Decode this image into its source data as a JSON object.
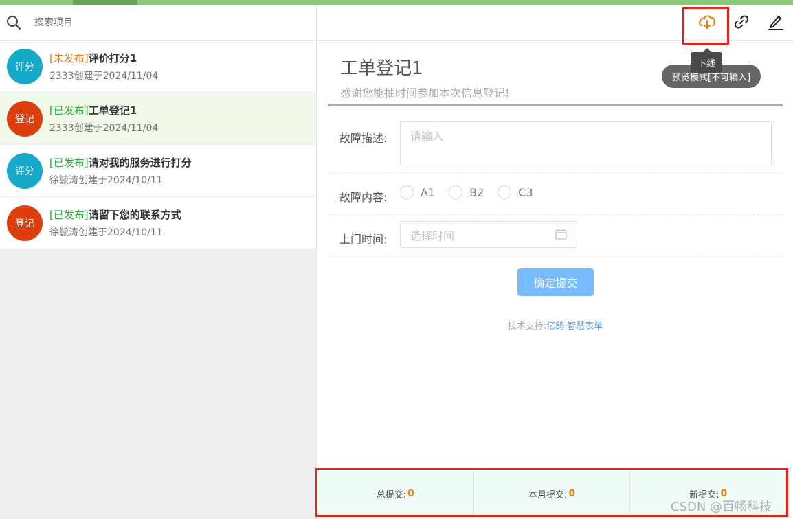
{
  "search": {
    "placeholder": "搜索项目"
  },
  "projects": [
    {
      "avatar": "评分",
      "status": "[未发布]",
      "title": "评价打分1",
      "sub": "2333创建于2024/11/04"
    },
    {
      "avatar": "登记",
      "status": "[已发布]",
      "title": "工单登记1",
      "sub": "2333创建于2024/11/04"
    },
    {
      "avatar": "评分",
      "status": "[已发布]",
      "title": "请对我的服务进行打分",
      "sub": "徐毓涛创建于2024/10/11"
    },
    {
      "avatar": "登记",
      "status": "[已发布]",
      "title": "请留下您的联系方式",
      "sub": "徐毓涛创建于2024/10/11"
    }
  ],
  "toolbar": {
    "icons": [
      "cloud-download-icon",
      "link-icon",
      "edit-icon"
    ],
    "tooltip": "下线",
    "preview_badge": "预览模式[不可输入]"
  },
  "form": {
    "title": "工单登记1",
    "description": "感谢您能抽时间参加本次信息登记!",
    "fields": {
      "desc_label": "故障描述:",
      "desc_placeholder": "请输入",
      "content_label": "故障内容:",
      "options": [
        "A1",
        "B2",
        "C3"
      ],
      "time_label": "上门时间:",
      "time_placeholder": "选择时间"
    },
    "submit_label": "确定提交",
    "support_prefix": "技术支持:",
    "support_link": "亿鸽·智慧表单"
  },
  "stats": [
    {
      "label": "总提交:",
      "value": "0"
    },
    {
      "label": "本月提交:",
      "value": "0"
    },
    {
      "label": "新提交:",
      "value": "0"
    }
  ],
  "watermark": "CSDN @百畅科技",
  "colors": {
    "accent_orange": "#f07a0a",
    "published_green": "#27b03a",
    "unpublished_orange": "#e57e16",
    "highlight_red": "#e8201a"
  }
}
